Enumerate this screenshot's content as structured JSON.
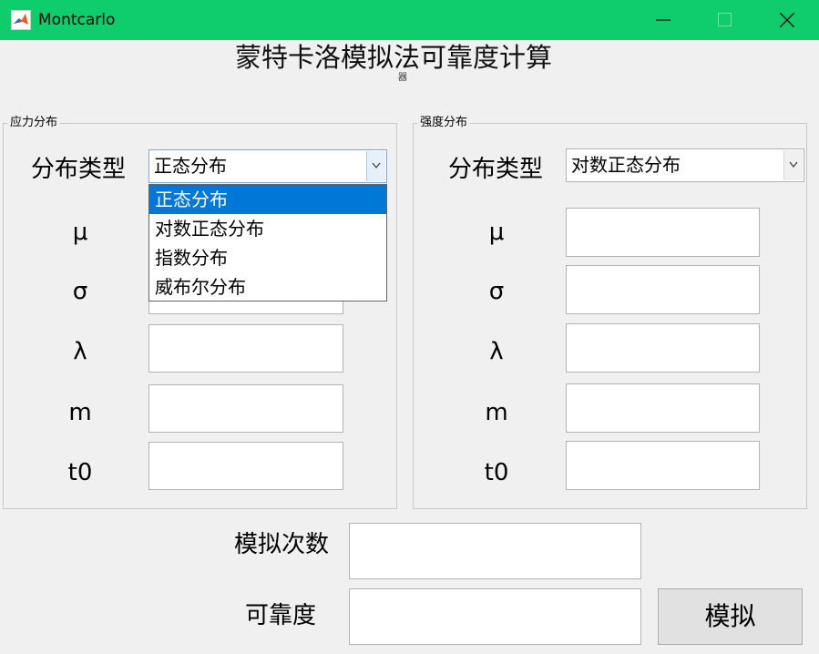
{
  "window": {
    "title": "Montcarlo",
    "icon": "matlab-logo-icon"
  },
  "header": {
    "title": "蒙特卡洛模拟法可靠度计算",
    "subtitle": "器"
  },
  "stress_panel": {
    "title": "应力分布",
    "dist_label": "分布类型",
    "dist_value": "正态分布",
    "options": [
      "正态分布",
      "对数正态分布",
      "指数分布",
      "威布尔分布"
    ],
    "selected_option_index": 0,
    "params": {
      "mu": "μ",
      "sigma": "σ",
      "lambda": "λ",
      "m": "m",
      "t0": "t0"
    }
  },
  "strength_panel": {
    "title": "强度分布",
    "dist_label": "分布类型",
    "dist_value": "对数正态分布",
    "params": {
      "mu": "μ",
      "sigma": "σ",
      "lambda": "λ",
      "m": "m",
      "t0": "t0"
    }
  },
  "bottom": {
    "sim_count_label": "模拟次数",
    "reliability_label": "可靠度",
    "simulate_button": "模拟"
  },
  "colors": {
    "titlebar": "#0fcc6c",
    "selection": "#0078d7"
  }
}
